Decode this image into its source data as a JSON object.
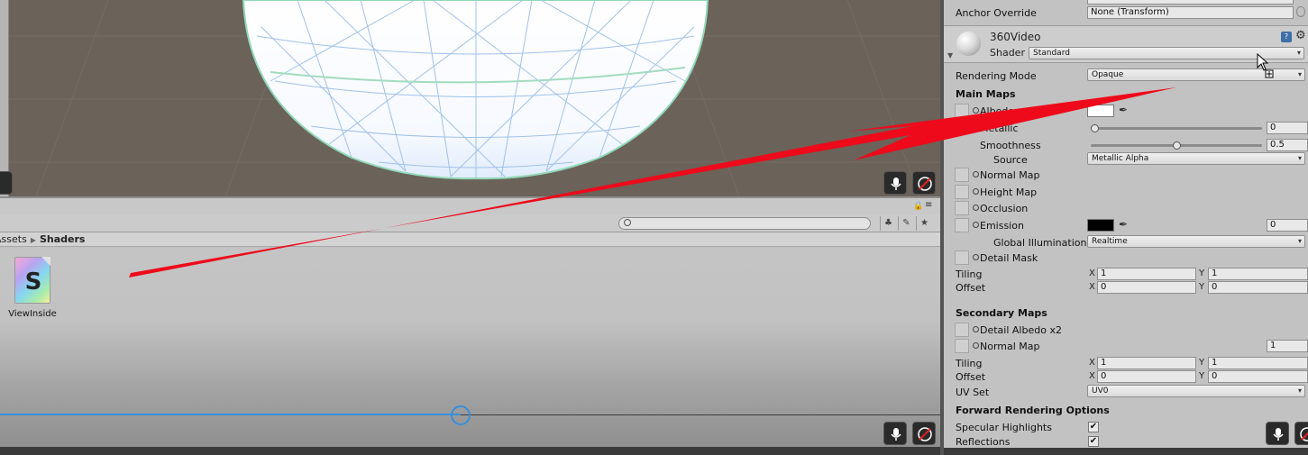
{
  "project": {
    "breadcrumb": {
      "root": "Assets",
      "current": "Shaders"
    },
    "search_placeholder": "",
    "asset": {
      "name": "ViewInside",
      "icon_letter": "S",
      "icon": "shader-file-icon"
    },
    "timeline_progress": 0.49
  },
  "inspector": {
    "anchor_override": {
      "label": "Anchor Override",
      "value": "None (Transform)"
    },
    "material": {
      "name": "360Video",
      "shader_label": "Shader",
      "shader_value": "Standard"
    },
    "rendering_mode": {
      "label": "Rendering Mode",
      "value": "Opaque"
    },
    "main_maps": {
      "title": "Main Maps",
      "albedo": "Albedo",
      "metallic": {
        "label": "Metallic",
        "value": "0",
        "fraction": 0.0
      },
      "smoothness": {
        "label": "Smoothness",
        "value": "0.5",
        "fraction": 0.5
      },
      "source": {
        "label": "Source",
        "value": "Metallic Alpha"
      },
      "normal_map": "Normal Map",
      "height_map": "Height Map",
      "occlusion": "Occlusion",
      "emission": {
        "label": "Emission",
        "value": "0"
      },
      "global_illumination": {
        "label": "Global Illumination",
        "value": "Realtime"
      },
      "detail_mask": "Detail Mask",
      "tiling": {
        "label": "Tiling",
        "x": "1",
        "y": "1"
      },
      "offset": {
        "label": "Offset",
        "x": "0",
        "y": "0"
      }
    },
    "secondary_maps": {
      "title": "Secondary Maps",
      "detail_albedo": "Detail Albedo x2",
      "normal_map": {
        "label": "Normal Map",
        "value": "1"
      },
      "tiling": {
        "label": "Tiling",
        "x": "1",
        "y": "1"
      },
      "offset": {
        "label": "Offset",
        "x": "0",
        "y": "0"
      },
      "uv_set": {
        "label": "UV Set",
        "value": "UV0"
      }
    },
    "forward_rendering": {
      "title": "Forward Rendering Options",
      "specular_highlights": {
        "label": "Specular Highlights",
        "checked": true
      },
      "reflections": {
        "label": "Reflections",
        "checked": true
      }
    },
    "axis_x": "X",
    "axis_y": "Y"
  },
  "colors": {
    "scene_background": "#6b6259",
    "panel_background": "#c2c2c2",
    "accent_blue": "#3a8fdc",
    "annotation_arrow": "#ee0a1a",
    "albedo_color": "#ffffff",
    "emission_color": "#000000"
  }
}
